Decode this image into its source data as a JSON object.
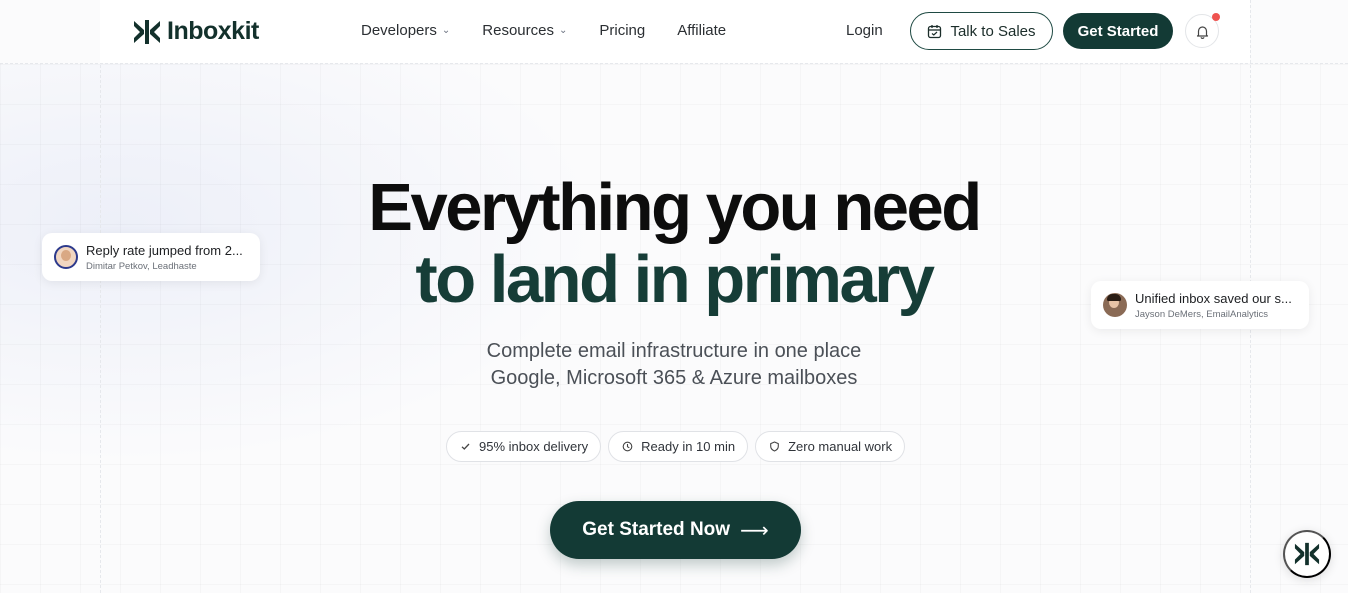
{
  "colors": {
    "brand": "#133a35",
    "accent_dot": "#ef5350"
  },
  "header": {
    "logo_text": "Inboxkit",
    "nav": [
      {
        "label": "Developers",
        "has_dropdown": true
      },
      {
        "label": "Resources",
        "has_dropdown": true
      },
      {
        "label": "Pricing",
        "has_dropdown": false
      },
      {
        "label": "Affiliate",
        "has_dropdown": false
      }
    ],
    "login_label": "Login",
    "talk_label": "Talk to Sales",
    "get_started_label": "Get Started"
  },
  "hero": {
    "line1": "Everything you need",
    "line2": "to land in primary",
    "sub1": "Complete email infrastructure in one place",
    "sub2": "Google, Microsoft 365 & Azure mailboxes",
    "pills": [
      {
        "icon": "check-icon",
        "label": "95% inbox delivery"
      },
      {
        "icon": "clock-icon",
        "label": "Ready in 10 min"
      },
      {
        "icon": "shield-icon",
        "label": "Zero manual work"
      }
    ],
    "cta_label": "Get Started Now"
  },
  "testimonials": [
    {
      "quote": "Reply rate jumped from 2...",
      "author": "Dimitar Petkov, Leadhaste"
    },
    {
      "quote": "Unified inbox saved our s...",
      "author": "Jayson DeMers, EmailAnalytics"
    }
  ]
}
